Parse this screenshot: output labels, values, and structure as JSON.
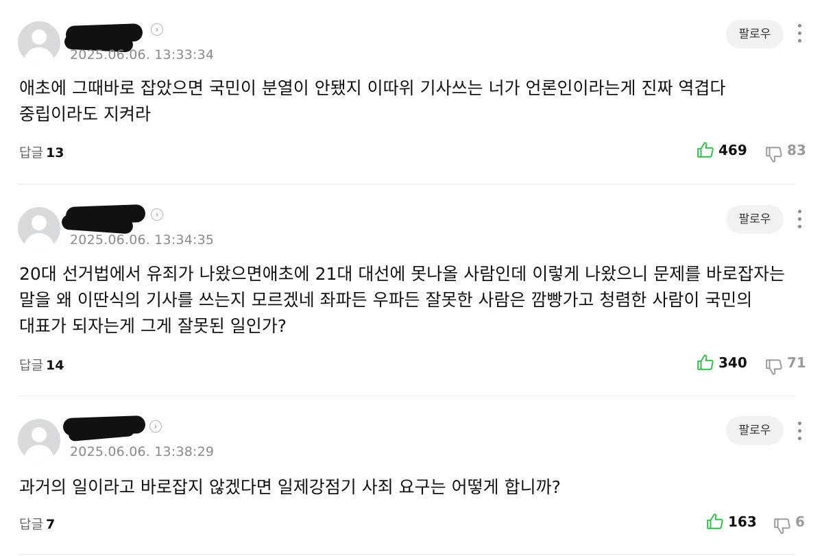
{
  "comments": [
    {
      "date": "2025.06.06. 13:33:34",
      "follow_label": "팔로우",
      "text": "애초에 그때바로 잡았으면 국민이 분열이 안됐지 이따위 기사쓰는 너가 언론인이라는게 진짜 역겹다 중립이라도 지켜라",
      "reply_label": "답글",
      "reply_count": "13",
      "likes": "469",
      "dislikes": "83"
    },
    {
      "date": "2025.06.06. 13:34:35",
      "follow_label": "팔로우",
      "text": "20대 선거법에서 유죄가 나왔으면애초에 21대 대선에 못나올 사람인데 이렇게 나왔으니 문제를 바로잡자는 말을 왜 이딴식의 기사를 쓰는지 모르겠네 좌파든 우파든 잘못한 사람은 깜빵가고 청렴한 사람이 국민의 대표가 되자는게 그게 잘못된 일인가?",
      "reply_label": "답글",
      "reply_count": "14",
      "likes": "340",
      "dislikes": "71"
    },
    {
      "date": "2025.06.06. 13:38:29",
      "follow_label": "팔로우",
      "text": "과거의 일이라고 바로잡지 않겠다면 일제강점기 사죄 요구는 어떻게 합니까?",
      "reply_label": "답글",
      "reply_count": "7",
      "likes": "163",
      "dislikes": "6"
    }
  ],
  "colors": {
    "like_green": "#2fbd4a",
    "dislike_gray": "#9a9a9a",
    "follow_bg": "#f2f2f2"
  },
  "icons": [
    "avatar-placeholder",
    "chevron-right-icon",
    "more-vertical-icon",
    "thumb-up-icon",
    "thumb-down-icon"
  ]
}
